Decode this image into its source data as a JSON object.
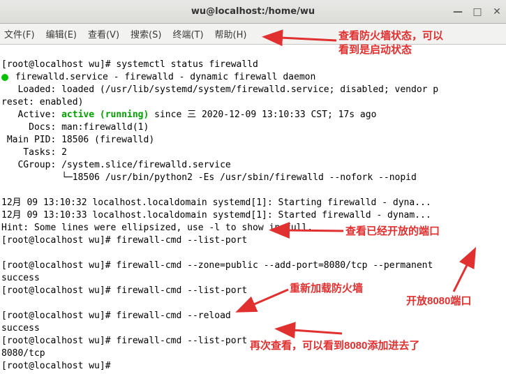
{
  "window": {
    "title": "wu@localhost:/home/wu"
  },
  "menu": {
    "file": "文件(F)",
    "edit": "编辑(E)",
    "view": "查看(V)",
    "search": "搜索(S)",
    "terminal": "终端(T)",
    "help": "帮助(H)"
  },
  "term": {
    "prompt": "[root@localhost wu]#",
    "cmd_status": "systemctl status firewalld",
    "svc_line": "firewalld.service - firewalld - dynamic firewall daemon",
    "loaded": "   Loaded: loaded (/usr/lib/systemd/system/firewalld.service; disabled; vendor p",
    "loaded2": "reset: enabled)",
    "active_label": "   Active: ",
    "active_val": "active (running)",
    "active_rest": " since 三 2020-12-09 13:10:33 CST; 17s ago",
    "docs": "     Docs: man:firewalld(1)",
    "mainpid": " Main PID: 18506 (firewalld)",
    "tasks": "    Tasks: 2",
    "cgroup": "   CGroup: /system.slice/firewalld.service",
    "cgroup2": "           └─18506 /usr/bin/python2 -Es /usr/sbin/firewalld --nofork --nopid",
    "log1": "12月 09 13:10:32 localhost.localdomain systemd[1]: Starting firewalld - dyna...",
    "log2": "12月 09 13:10:33 localhost.localdomain systemd[1]: Started firewalld - dynam...",
    "hint": "Hint: Some lines were ellipsized, use -l to show in full.",
    "cmd_listport1": "firewall-cmd --list-port",
    "cmd_addport": "firewall-cmd --zone=public --add-port=8080/tcp --permanent",
    "success": "success",
    "cmd_listport2": "firewall-cmd --list-port",
    "cmd_reload": "firewall-cmd --reload",
    "cmd_listport3": "firewall-cmd --list-port",
    "port_out": "8080/tcp"
  },
  "annotations": {
    "a1": "查看防火墙状态，可以\n看到是启动状态",
    "a2": "查看已经开放的端口",
    "a3": "重新加载防火墙",
    "a4": "开放8080端口",
    "a5": "再次查看，可以看到8080添加进去了"
  }
}
